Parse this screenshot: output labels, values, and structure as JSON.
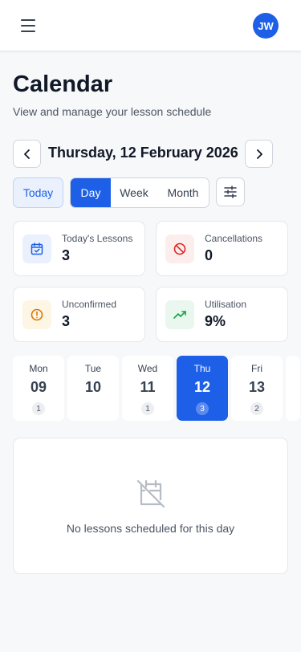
{
  "header": {
    "avatar_initials": "JW",
    "menu_icon": "menu-icon"
  },
  "page": {
    "title": "Calendar",
    "subtitle": "View and manage your lesson schedule"
  },
  "date_nav": {
    "current_date": "Thursday, 12 February 2026",
    "prev_icon": "chevron-left-icon",
    "next_icon": "chevron-right-icon"
  },
  "toolbar": {
    "today_label": "Today",
    "views": [
      "Day",
      "Week",
      "Month"
    ],
    "active_view": "Day",
    "filter_icon": "sliders-icon"
  },
  "stats": [
    {
      "label": "Today's Lessons",
      "value": "3",
      "icon": "calendar-check-icon",
      "color": "#1d5fe6",
      "bg": "#eaf1fd"
    },
    {
      "label": "Cancellations",
      "value": "0",
      "icon": "ban-icon",
      "color": "#dc2626",
      "bg": "#fdeeee"
    },
    {
      "label": "Unconfirmed",
      "value": "3",
      "icon": "alert-circle-icon",
      "color": "#d97706",
      "bg": "#fef6e4"
    },
    {
      "label": "Utilisation",
      "value": "9%",
      "icon": "trending-up-icon",
      "color": "#16a34a",
      "bg": "#e9f7ee"
    }
  ],
  "days": [
    {
      "name": "Mon",
      "num": "09",
      "count": "1"
    },
    {
      "name": "Tue",
      "num": "10",
      "count": ""
    },
    {
      "name": "Wed",
      "num": "11",
      "count": "1"
    },
    {
      "name": "Thu",
      "num": "12",
      "count": "3",
      "active": true
    },
    {
      "name": "Fri",
      "num": "13",
      "count": "2"
    }
  ],
  "empty_state": {
    "text": "No lessons scheduled for this day",
    "icon": "calendar-off-icon"
  },
  "colors": {
    "accent": "#1d5fe6"
  }
}
